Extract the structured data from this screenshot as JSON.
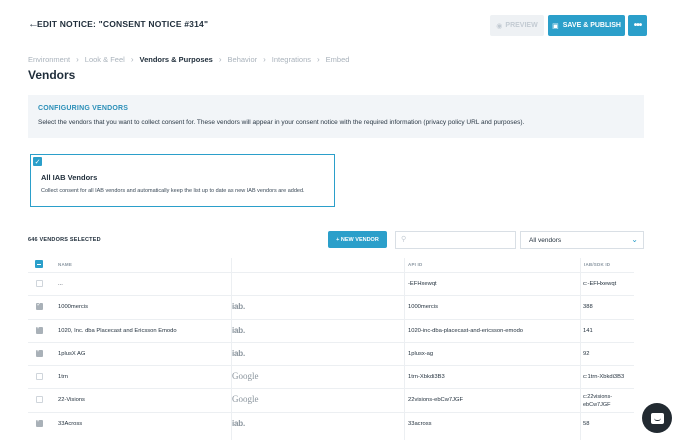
{
  "header": {
    "title": "EDIT NOTICE: \"CONSENT NOTICE #314\"",
    "preview_label": "PREVIEW",
    "publish_label": "SAVE & PUBLISH",
    "more_label": "•••"
  },
  "breadcrumb": [
    {
      "label": "Environment",
      "active": false
    },
    {
      "label": "Look & Feel",
      "active": false
    },
    {
      "label": "Vendors & Purposes",
      "active": true
    },
    {
      "label": "Behavior",
      "active": false
    },
    {
      "label": "Integrations",
      "active": false
    },
    {
      "label": "Embed",
      "active": false
    }
  ],
  "page_title": "Vendors",
  "info": {
    "heading": "CONFIGURING VENDORS",
    "text": "Select the vendors that you want to collect consent for. These vendors will appear in your consent notice with the required information (privacy policy URL and purposes)."
  },
  "iab_card": {
    "checked": true,
    "title": "All IAB Vendors",
    "description": "Collect consent for all IAB vendors and automatically keep the list up to date as new IAB vendors are added."
  },
  "toolbar": {
    "selected_count": "646 VENDORS SELECTED",
    "new_vendor_label": "+ NEW VENDOR",
    "search_placeholder": "",
    "filter_value": "All vendors"
  },
  "table": {
    "columns": [
      "NAME",
      "",
      "API ID",
      "IAB/SDK ID"
    ],
    "rows": [
      {
        "checked": false,
        "name": "...",
        "logo": "",
        "api_id": "-EFHxewqt",
        "ids": "c:-EFHxewqt"
      },
      {
        "checked": true,
        "name": "1000mercis",
        "logo": "iab.",
        "api_id": "1000mercis",
        "ids": "388"
      },
      {
        "checked": true,
        "name": "1020, Inc. dba Placecast and Ericsson Emodo",
        "logo": "iab.",
        "api_id": "1020-inc-dba-placecast-and-ericsson-emodo",
        "ids": "141"
      },
      {
        "checked": true,
        "name": "1plusX AG",
        "logo": "iab.",
        "api_id": "1plusx-ag",
        "ids": "92"
      },
      {
        "checked": false,
        "name": "1trn",
        "logo": "Google",
        "api_id": "1trn-Xbkdi3B3",
        "ids": "c:1trn-Xbkdi3B3"
      },
      {
        "checked": false,
        "name": "22-Visions",
        "logo": "Google",
        "api_id": "22visions-ebCw7JGF",
        "ids": "c:22visions-\nebCw7JGF"
      },
      {
        "checked": true,
        "name": "33Across",
        "logo": "iab.",
        "api_id": "33across",
        "ids": "58"
      }
    ]
  }
}
